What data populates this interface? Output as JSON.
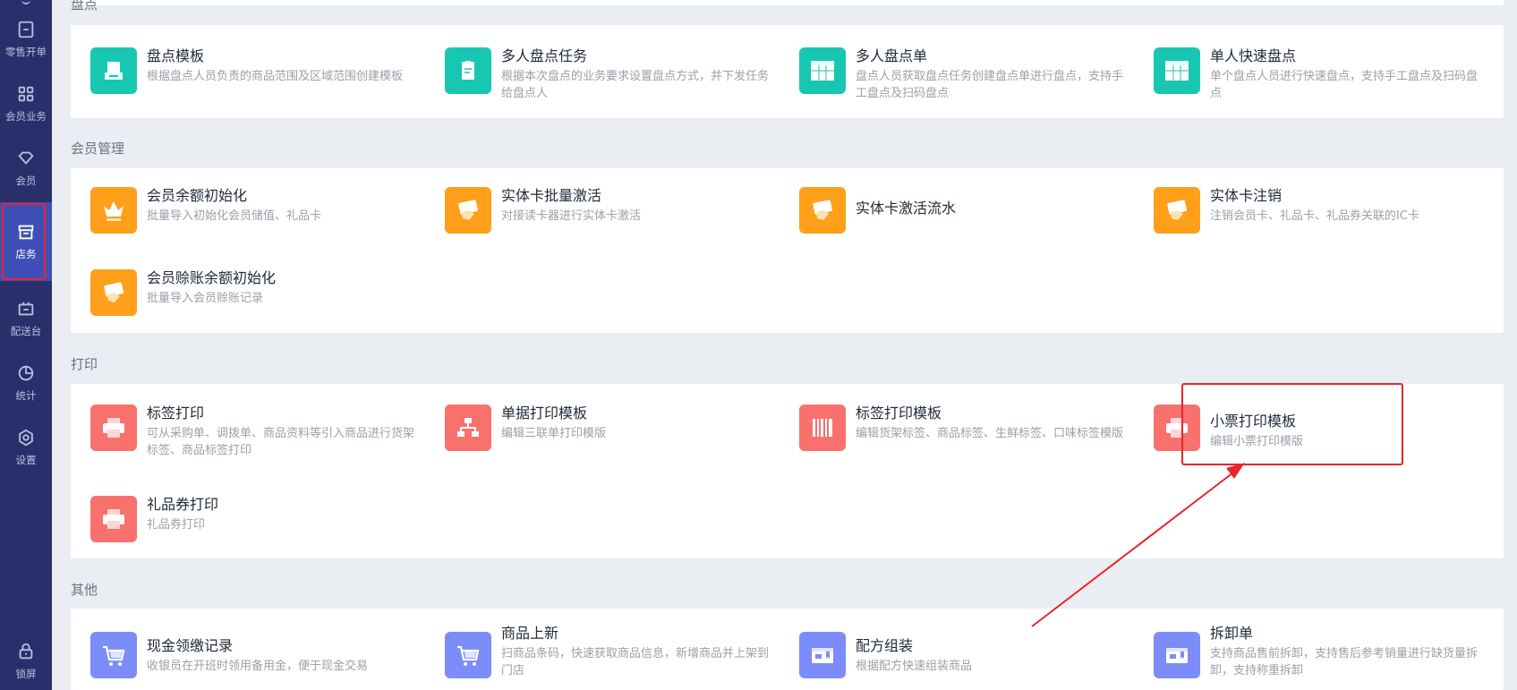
{
  "sidebar": {
    "items": [
      {
        "label": "零售开单",
        "icon": "receipt-icon"
      },
      {
        "label": "会员业务",
        "icon": "grid-icon"
      },
      {
        "label": "会员",
        "icon": "diamond-icon"
      },
      {
        "label": "店务",
        "icon": "store-icon",
        "active": true
      },
      {
        "label": "配送台",
        "icon": "delivery-box-icon"
      },
      {
        "label": "统计",
        "icon": "pie-chart-icon"
      },
      {
        "label": "设置",
        "icon": "gear-icon"
      }
    ],
    "lock_label": "锁屏"
  },
  "sections": {
    "inventory": {
      "title": "盘点",
      "tiles": [
        {
          "name": "盘点模板",
          "desc": "根据盘点人员负责的商品范围及区域范围创建模板",
          "icon": "scanner-icon",
          "color": "#18c7b2"
        },
        {
          "name": "多人盘点任务",
          "desc": "根据本次盘点的业务要求设置盘点方式，并下发任务给盘点人",
          "icon": "clipboard-icon",
          "color": "#18c7b2"
        },
        {
          "name": "多人盘点单",
          "desc": "盘点人员获取盘点任务创建盘点单进行盘点，支持手工盘点及扫码盘点",
          "icon": "table-icon",
          "color": "#18c7b2"
        },
        {
          "name": "单人快速盘点",
          "desc": "单个盘点人员进行快速盘点，支持手工盘点及扫码盘点",
          "icon": "table-icon",
          "color": "#18c7b2"
        }
      ]
    },
    "member": {
      "title": "会员管理",
      "tiles": [
        {
          "name": "会员余额初始化",
          "desc": "批量导入初始化会员储值、礼品卡",
          "icon": "crown-icon",
          "color": "#ff9f1a"
        },
        {
          "name": "实体卡批量激活",
          "desc": "对接读卡器进行实体卡激活",
          "icon": "card-hand-icon",
          "color": "#ff9f1a"
        },
        {
          "name": "实体卡激活流水",
          "desc": "",
          "icon": "card-hand-icon",
          "color": "#ff9f1a"
        },
        {
          "name": "实体卡注销",
          "desc": "注销会员卡、礼品卡、礼品券关联的IC卡",
          "icon": "card-hand-icon",
          "color": "#ff9f1a"
        },
        {
          "name": "会员赊账余额初始化",
          "desc": "批量导入会员赊账记录",
          "icon": "card-hand-icon",
          "color": "#ff9f1a"
        }
      ]
    },
    "print": {
      "title": "打印",
      "tiles": [
        {
          "name": "标签打印",
          "desc": "可从采购单、调拨单、商品资料等引入商品进行货架标签、商品标签打印",
          "icon": "printer-icon",
          "color": "#f8716c"
        },
        {
          "name": "单据打印模板",
          "desc": "编辑三联单打印模版",
          "icon": "org-chart-icon",
          "color": "#f8716c"
        },
        {
          "name": "标签打印模板",
          "desc": "编辑货架标签、商品标签、生鲜标签、口味标签模版",
          "icon": "barcode-icon",
          "color": "#f8716c"
        },
        {
          "name": "小票打印模板",
          "desc": "编辑小票打印模版",
          "icon": "printer-icon",
          "color": "#f8716c"
        },
        {
          "name": "礼品券打印",
          "desc": "礼品券打印",
          "icon": "printer-icon",
          "color": "#f8716c"
        }
      ]
    },
    "other": {
      "title": "其他",
      "tiles": [
        {
          "name": "现金领缴记录",
          "desc": "收银员在开班时领用备用金，便于现金交易",
          "icon": "cart-icon",
          "color": "#7c8cf8"
        },
        {
          "name": "商品上新",
          "desc": "扫商品条码，快速获取商品信息，新增商品并上架到门店",
          "icon": "cart-icon",
          "color": "#7c8cf8"
        },
        {
          "name": "配方组装",
          "desc": "根据配方快速组装商品",
          "icon": "box-icon",
          "color": "#7c8cf8"
        },
        {
          "name": "拆卸单",
          "desc": "支持商品售前拆卸，支持售后参考销量进行缺货量拆卸，支持称重拆卸",
          "icon": "box-icon",
          "color": "#7c8cf8"
        }
      ]
    }
  },
  "colors": {
    "sidebar_bg": "#2a2f6b",
    "sidebar_active": "#3f4fb8",
    "highlight_red": "#e8262c"
  }
}
